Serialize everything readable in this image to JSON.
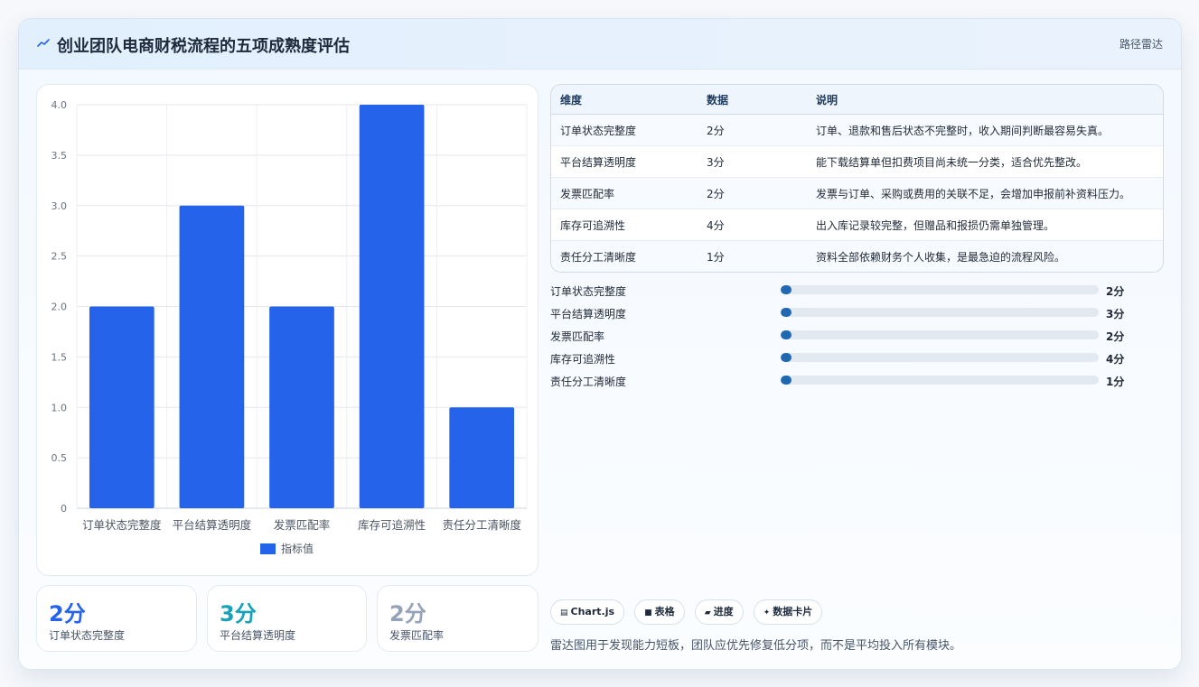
{
  "header": {
    "title": "创业团队电商财税流程的五项成熟度评估",
    "route_tag": "路径雷达",
    "icon": "line-chart-icon"
  },
  "chart_data": {
    "type": "bar",
    "categories": [
      "订单状态完整度",
      "平台结算透明度",
      "发票匹配率",
      "库存可追溯性",
      "责任分工清晰度"
    ],
    "series": [
      {
        "name": "指标值",
        "values": [
          2,
          3,
          2,
          4,
          1
        ]
      }
    ],
    "ylim": [
      0,
      4
    ],
    "yticks": [
      "4.0",
      "3.5",
      "3.0",
      "2.5",
      "2.0",
      "1.5",
      "1.0",
      "0.5",
      "0"
    ],
    "ytick_values": [
      4,
      3.5,
      3,
      2.5,
      2,
      1.5,
      1,
      0.5,
      0
    ],
    "grid": true,
    "legend": "bottom",
    "bar_color": "#2563eb"
  },
  "stats": [
    {
      "value": "2分",
      "label": "订单状态完整度",
      "color": "#2563eb"
    },
    {
      "value": "3分",
      "label": "平台结算透明度",
      "color": "#17a2b8"
    },
    {
      "value": "2分",
      "label": "发票匹配率",
      "color": "#94a3b8"
    }
  ],
  "table": {
    "headers": [
      "维度",
      "数据",
      "说明"
    ],
    "rows": [
      [
        "订单状态完整度",
        "2分",
        "订单、退款和售后状态不完整时，收入期间判断最容易失真。"
      ],
      [
        "平台结算透明度",
        "3分",
        "能下载结算单但扣费项目尚未统一分类，适合优先整改。"
      ],
      [
        "发票匹配率",
        "2分",
        "发票与订单、采购或费用的关联不足，会增加申报前补资料压力。"
      ],
      [
        "库存可追溯性",
        "4分",
        "出入库记录较完整，但赠品和报损仍需单独管理。"
      ],
      [
        "责任分工清晰度",
        "1分",
        "资料全部依赖财务个人收集，是最急迫的流程风险。"
      ]
    ]
  },
  "progress": [
    {
      "label": "订单状态完整度",
      "value": "2分",
      "fraction": 0.035
    },
    {
      "label": "平台结算透明度",
      "value": "3分",
      "fraction": 0.035
    },
    {
      "label": "发票匹配率",
      "value": "2分",
      "fraction": 0.035
    },
    {
      "label": "库存可追溯性",
      "value": "4分",
      "fraction": 0.035
    },
    {
      "label": "责任分工清晰度",
      "value": "1分",
      "fraction": 0.035
    }
  ],
  "chips": [
    {
      "icon": "chart-icon",
      "glyph": "▤",
      "label": "Chart.js"
    },
    {
      "icon": "table-icon",
      "glyph": "■",
      "label": "表格"
    },
    {
      "icon": "progress-icon",
      "glyph": "▰",
      "label": "进度"
    },
    {
      "icon": "sparkle-icon",
      "glyph": "✦",
      "label": "数据卡片"
    }
  ],
  "footnote": "雷达图用于发现能力短板，团队应优先修复低分项，而不是平均投入所有模块。"
}
